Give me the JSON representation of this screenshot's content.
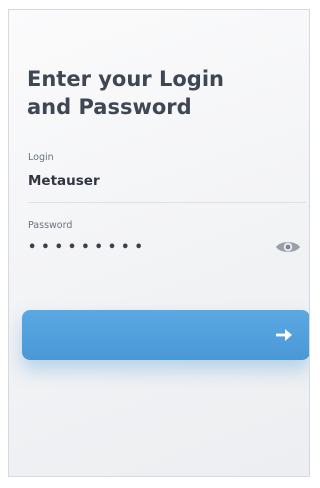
{
  "heading": {
    "line1": "Enter your Login",
    "line2": "and Password"
  },
  "login": {
    "label": "Login",
    "value": "Metauser"
  },
  "password": {
    "label": "Password",
    "masked_value": "•••••••••",
    "toggle_icon": "eye-icon"
  },
  "submit": {
    "icon": "arrow-right-icon",
    "color": "#4a98d6"
  }
}
